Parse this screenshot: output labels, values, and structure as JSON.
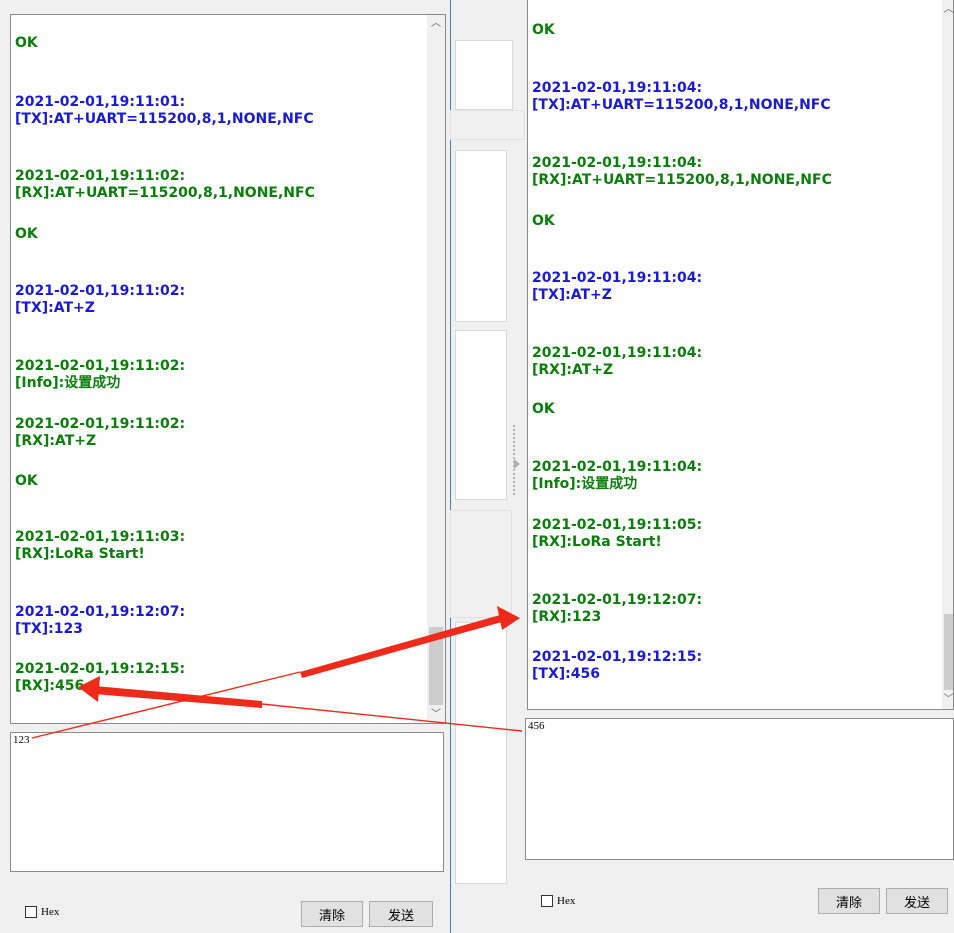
{
  "left": {
    "entries": [
      {
        "type": "rx",
        "lines": [
          "OK"
        ]
      },
      {
        "type": "tx",
        "lines": [
          "2021-02-01,19:11:01:",
          "[TX]:AT+UART=115200,8,1,NONE,NFC"
        ]
      },
      {
        "type": "rx",
        "lines": [
          "2021-02-01,19:11:02:",
          "[RX]:AT+UART=115200,8,1,NONE,NFC"
        ]
      },
      {
        "type": "rx",
        "lines": [
          "OK"
        ]
      },
      {
        "type": "tx",
        "lines": [
          "2021-02-01,19:11:02:",
          "[TX]:AT+Z"
        ]
      },
      {
        "type": "info",
        "lines": [
          "2021-02-01,19:11:02:",
          "[Info]:设置成功"
        ]
      },
      {
        "type": "rx",
        "lines": [
          "2021-02-01,19:11:02:",
          "[RX]:AT+Z"
        ]
      },
      {
        "type": "rx",
        "lines": [
          "OK"
        ]
      },
      {
        "type": "rx",
        "lines": [
          "2021-02-01,19:11:03:",
          "[RX]:LoRa Start!"
        ]
      },
      {
        "type": "tx",
        "lines": [
          "2021-02-01,19:12:07:",
          "[TX]:123"
        ]
      },
      {
        "type": "rx",
        "lines": [
          "2021-02-01,19:12:15:",
          "[RX]:456"
        ]
      }
    ],
    "input_value": "123",
    "hex_label": "Hex",
    "clear_label": "清除",
    "send_label": "发送"
  },
  "right": {
    "entries": [
      {
        "type": "rx",
        "lines": [
          "OK"
        ]
      },
      {
        "type": "tx",
        "lines": [
          "2021-02-01,19:11:04:",
          "[TX]:AT+UART=115200,8,1,NONE,NFC"
        ]
      },
      {
        "type": "rx",
        "lines": [
          "2021-02-01,19:11:04:",
          "[RX]:AT+UART=115200,8,1,NONE,NFC"
        ]
      },
      {
        "type": "rx",
        "lines": [
          "OK"
        ]
      },
      {
        "type": "tx",
        "lines": [
          "2021-02-01,19:11:04:",
          "[TX]:AT+Z"
        ]
      },
      {
        "type": "rx",
        "lines": [
          "2021-02-01,19:11:04:",
          "[RX]:AT+Z"
        ]
      },
      {
        "type": "rx",
        "lines": [
          "OK"
        ]
      },
      {
        "type": "info",
        "lines": [
          "2021-02-01,19:11:04:",
          "[Info]:设置成功"
        ]
      },
      {
        "type": "rx",
        "lines": [
          "2021-02-01,19:11:05:",
          "[RX]:LoRa Start!"
        ]
      },
      {
        "type": "rx",
        "lines": [
          "2021-02-01,19:12:07:",
          "[RX]:123"
        ]
      },
      {
        "type": "tx",
        "lines": [
          "2021-02-01,19:12:15:",
          "[TX]:456"
        ]
      }
    ],
    "input_value": "456",
    "hex_label": "Hex",
    "clear_label": "清除",
    "send_label": "发送"
  },
  "colors": {
    "tx": "#1a1ad6",
    "rx": "#0a7e0a",
    "arrow": "#f02a1a"
  },
  "icons": {
    "scroll_up": "▲-icon",
    "scroll_down": "▼-icon"
  }
}
